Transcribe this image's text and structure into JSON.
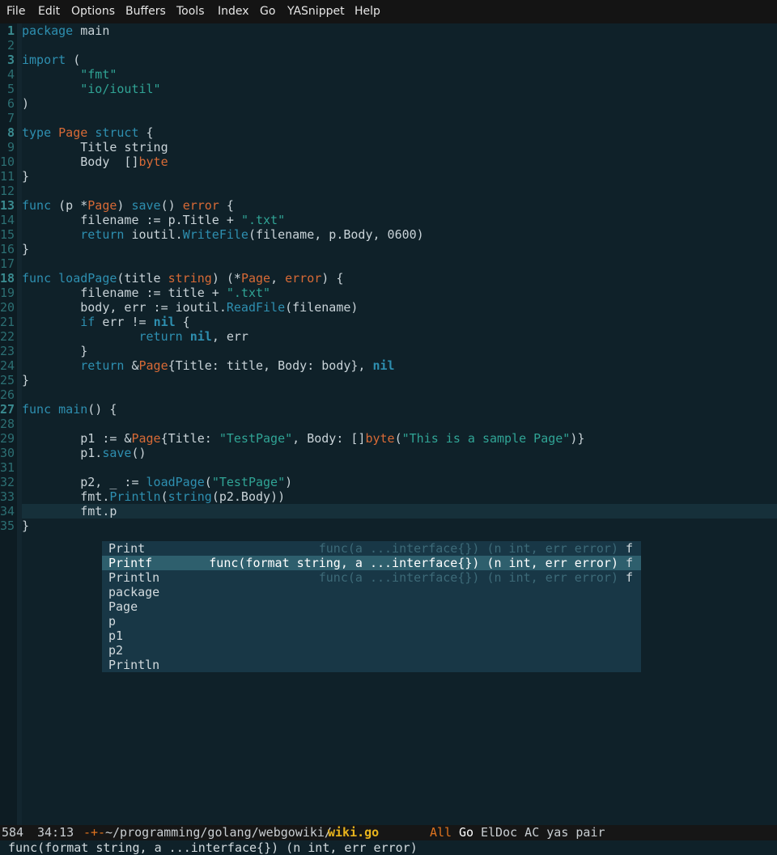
{
  "menubar": {
    "items": [
      "File",
      "Edit",
      "Options",
      "Buffers",
      "Tools",
      "Index",
      "Go",
      "YASnippet",
      "Help"
    ]
  },
  "editor": {
    "lines": [
      {
        "n": "1",
        "tokens": [
          [
            "kw",
            "package"
          ],
          [
            "plain",
            " main"
          ]
        ]
      },
      {
        "n": "2",
        "tokens": []
      },
      {
        "n": "3",
        "tokens": [
          [
            "kw",
            "import"
          ],
          [
            "plain",
            " ("
          ]
        ]
      },
      {
        "n": "4",
        "tokens": [
          [
            "plain",
            "        "
          ],
          [
            "str",
            "\"fmt\""
          ]
        ]
      },
      {
        "n": "5",
        "tokens": [
          [
            "plain",
            "        "
          ],
          [
            "str",
            "\"io/ioutil\""
          ]
        ]
      },
      {
        "n": "6",
        "tokens": [
          [
            "plain",
            ")"
          ]
        ]
      },
      {
        "n": "7",
        "tokens": []
      },
      {
        "n": "8",
        "tokens": [
          [
            "kw",
            "type"
          ],
          [
            "plain",
            " "
          ],
          [
            "type",
            "Page"
          ],
          [
            "plain",
            " "
          ],
          [
            "kw",
            "struct"
          ],
          [
            "plain",
            " {"
          ]
        ]
      },
      {
        "n": "9",
        "tokens": [
          [
            "plain",
            "        Title string"
          ]
        ]
      },
      {
        "n": "10",
        "tokens": [
          [
            "plain",
            "        Body  []"
          ],
          [
            "type",
            "byte"
          ]
        ]
      },
      {
        "n": "11",
        "tokens": [
          [
            "plain",
            "}"
          ]
        ]
      },
      {
        "n": "12",
        "tokens": []
      },
      {
        "n": "13",
        "tokens": [
          [
            "kw",
            "func"
          ],
          [
            "plain",
            " (p *"
          ],
          [
            "type",
            "Page"
          ],
          [
            "plain",
            ") "
          ],
          [
            "fn",
            "save"
          ],
          [
            "plain",
            "() "
          ],
          [
            "type",
            "error"
          ],
          [
            "plain",
            " {"
          ]
        ]
      },
      {
        "n": "14",
        "tokens": [
          [
            "plain",
            "        filename := p.Title + "
          ],
          [
            "str",
            "\".txt\""
          ]
        ]
      },
      {
        "n": "15",
        "tokens": [
          [
            "plain",
            "        "
          ],
          [
            "kw",
            "return"
          ],
          [
            "plain",
            " ioutil."
          ],
          [
            "fn",
            "WriteFile"
          ],
          [
            "plain",
            "(filename, p.Body, 0600)"
          ]
        ]
      },
      {
        "n": "16",
        "tokens": [
          [
            "plain",
            "}"
          ]
        ]
      },
      {
        "n": "17",
        "tokens": []
      },
      {
        "n": "18",
        "tokens": [
          [
            "kw",
            "func"
          ],
          [
            "plain",
            " "
          ],
          [
            "fn",
            "loadPage"
          ],
          [
            "plain",
            "(title "
          ],
          [
            "type",
            "string"
          ],
          [
            "plain",
            ") (*"
          ],
          [
            "type",
            "Page"
          ],
          [
            "plain",
            ", "
          ],
          [
            "type",
            "error"
          ],
          [
            "plain",
            ") {"
          ]
        ]
      },
      {
        "n": "19",
        "tokens": [
          [
            "plain",
            "        filename := title + "
          ],
          [
            "str",
            "\".txt\""
          ]
        ]
      },
      {
        "n": "20",
        "tokens": [
          [
            "plain",
            "        body, err := ioutil."
          ],
          [
            "fn",
            "ReadFile"
          ],
          [
            "plain",
            "(filename)"
          ]
        ]
      },
      {
        "n": "21",
        "tokens": [
          [
            "plain",
            "        "
          ],
          [
            "kw",
            "if"
          ],
          [
            "plain",
            " err != "
          ],
          [
            "blt",
            "nil"
          ],
          [
            "plain",
            " {"
          ]
        ]
      },
      {
        "n": "22",
        "tokens": [
          [
            "plain",
            "                "
          ],
          [
            "kw",
            "return"
          ],
          [
            "plain",
            " "
          ],
          [
            "blt",
            "nil"
          ],
          [
            "plain",
            ", err"
          ]
        ]
      },
      {
        "n": "23",
        "tokens": [
          [
            "plain",
            "        }"
          ]
        ]
      },
      {
        "n": "24",
        "tokens": [
          [
            "plain",
            "        "
          ],
          [
            "kw",
            "return"
          ],
          [
            "plain",
            " &"
          ],
          [
            "type",
            "Page"
          ],
          [
            "plain",
            "{Title: title, Body: body}, "
          ],
          [
            "blt",
            "nil"
          ]
        ]
      },
      {
        "n": "25",
        "tokens": [
          [
            "plain",
            "}"
          ]
        ]
      },
      {
        "n": "26",
        "tokens": []
      },
      {
        "n": "27",
        "tokens": [
          [
            "kw",
            "func"
          ],
          [
            "plain",
            " "
          ],
          [
            "fn",
            "main"
          ],
          [
            "plain",
            "() {"
          ]
        ]
      },
      {
        "n": "28",
        "tokens": []
      },
      {
        "n": "29",
        "tokens": [
          [
            "plain",
            "        p1 := &"
          ],
          [
            "type",
            "Page"
          ],
          [
            "plain",
            "{Title: "
          ],
          [
            "str",
            "\"TestPage\""
          ],
          [
            "plain",
            ", Body: []"
          ],
          [
            "type",
            "byte"
          ],
          [
            "plain",
            "("
          ],
          [
            "str",
            "\"This is a sample Page\""
          ],
          [
            "plain",
            ")}"
          ]
        ]
      },
      {
        "n": "30",
        "tokens": [
          [
            "plain",
            "        p1."
          ],
          [
            "fn",
            "save"
          ],
          [
            "plain",
            "()"
          ]
        ]
      },
      {
        "n": "31",
        "tokens": []
      },
      {
        "n": "32",
        "tokens": [
          [
            "plain",
            "        p2, _ := "
          ],
          [
            "fn",
            "loadPage"
          ],
          [
            "plain",
            "("
          ],
          [
            "str",
            "\"TestPage\""
          ],
          [
            "plain",
            ")"
          ]
        ]
      },
      {
        "n": "33",
        "tokens": [
          [
            "plain",
            "        fmt."
          ],
          [
            "fn",
            "Println"
          ],
          [
            "plain",
            "("
          ],
          [
            "fn",
            "string"
          ],
          [
            "plain",
            "(p2.Body))"
          ]
        ]
      },
      {
        "n": "34",
        "tokens": [
          [
            "plain",
            "        fmt.p"
          ]
        ]
      },
      {
        "n": "35",
        "tokens": [
          [
            "plain",
            "}"
          ]
        ]
      }
    ],
    "bold_line_numbers": [
      "1",
      "3",
      "8",
      "13",
      "18",
      "27"
    ]
  },
  "completion": {
    "candidates": [
      {
        "name": "Print",
        "sig": "func(a ...interface{}) (n int, err error)",
        "kind": "f",
        "selected": false
      },
      {
        "name": "Printf",
        "sig": "func(format string, a ...interface{}) (n int, err error)",
        "kind": "f",
        "selected": true
      },
      {
        "name": "Println",
        "sig": "func(a ...interface{}) (n int, err error)",
        "kind": "f",
        "selected": false
      },
      {
        "name": "package",
        "sig": "",
        "kind": "",
        "selected": false
      },
      {
        "name": "Page",
        "sig": "",
        "kind": "",
        "selected": false
      },
      {
        "name": "p",
        "sig": "",
        "kind": "",
        "selected": false
      },
      {
        "name": "p1",
        "sig": "",
        "kind": "",
        "selected": false
      },
      {
        "name": "p2",
        "sig": "",
        "kind": "",
        "selected": false
      },
      {
        "name": "Println",
        "sig": "",
        "kind": "",
        "selected": false
      }
    ]
  },
  "modeline": {
    "buffer_size": "584",
    "position": "34:13",
    "modified_flag": "-+-",
    "path": "~/programming/golang/webgowiki/",
    "filename": "wiki.go",
    "scroll": "All",
    "major_mode": "Go",
    "minor_modes": "ElDoc AC yas pair"
  },
  "echo_area": {
    "text": "func(format string, a ...interface{}) (n int, err error)"
  },
  "colors": {
    "background": "#0f2129",
    "keyword": "#2e8fb0",
    "type": "#d86a36",
    "string": "#30a495",
    "line_number": "#2c6f73",
    "popup_bg": "#183746",
    "popup_selected": "#2e5f6d",
    "modeline_file": "#e8b31c",
    "modeline_flag": "#e0731e"
  }
}
